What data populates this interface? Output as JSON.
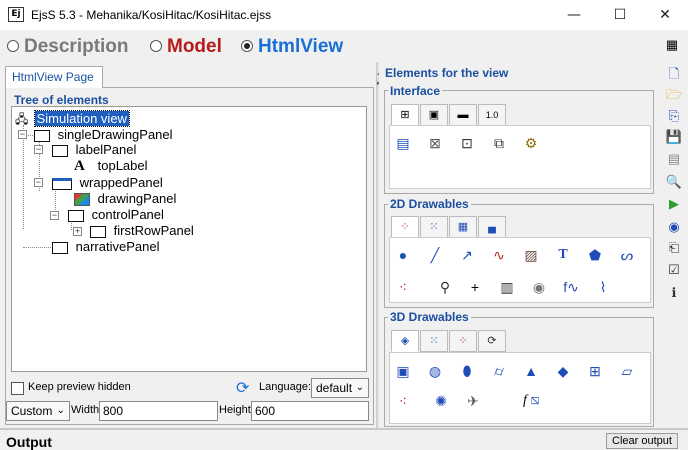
{
  "window": {
    "title": "EjsS 5.3 - Mehanika/KosiHitac/KosiHitac.ejss",
    "minimize": "—",
    "maximize": "☐",
    "close": "✕"
  },
  "tabs": [
    {
      "label": "Description",
      "color": "#7a7a7a"
    },
    {
      "label": "Model",
      "color": "#b71c1c"
    },
    {
      "label": "HtmlView",
      "color": "#1a6fd6"
    }
  ],
  "left": {
    "page_tab": "HtmlView Page",
    "tree_title": "Tree of elements",
    "tree": [
      {
        "label": "Simulation view"
      },
      {
        "label": "singleDrawingPanel"
      },
      {
        "label": "labelPanel"
      },
      {
        "label": "topLabel"
      },
      {
        "label": "wrappedPanel"
      },
      {
        "label": "drawingPanel"
      },
      {
        "label": "controlPanel"
      },
      {
        "label": "firstRowPanel"
      },
      {
        "label": "narrativePanel"
      }
    ],
    "keep_preview_hidden": "Keep preview hidden",
    "language_label": "Language:",
    "language_value": "default",
    "size_mode": "Custom",
    "width_label": "Width",
    "width_value": "800",
    "height_label": "Height",
    "height_value": "600"
  },
  "right": {
    "title": "Elements for the view",
    "interface_title": "Interface",
    "drawables2d_title": "2D Drawables",
    "drawables3d_title": "3D Drawables"
  },
  "bottom": {
    "output_label": "Output",
    "clear_output": "Clear output"
  }
}
